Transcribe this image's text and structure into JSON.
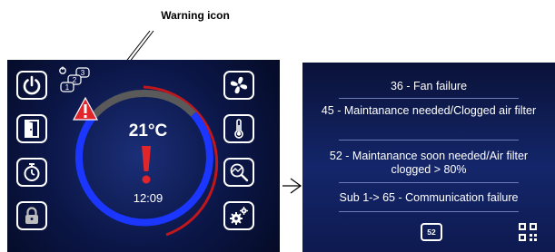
{
  "callout": {
    "label": "Warning icon"
  },
  "left_screen": {
    "temperature": "21°C",
    "time": "12:09",
    "unit_numbers": [
      "1",
      "2",
      "3"
    ],
    "left_buttons": [
      "power-icon",
      "door-icon",
      "timer-icon",
      "lock-icon"
    ],
    "right_buttons": [
      "fan-icon",
      "thermometer-icon",
      "chart-magnifier-icon",
      "gears-icon"
    ],
    "ring_colors": {
      "active": "#1a36ff",
      "inactive": "#5a5a5a",
      "outer": "#c0171d"
    },
    "warning_color": "#e0262b"
  },
  "right_screen": {
    "faults": [
      "36 - Fan failure",
      "45 - Maintanance needed/Clogged air filter",
      "52 - Maintanance soon needed/Air filter clogged  > 80%",
      "Sub  1-> 65 - Communication failure"
    ],
    "code_badge": "52",
    "qr_icon": "qr-code-icon"
  }
}
